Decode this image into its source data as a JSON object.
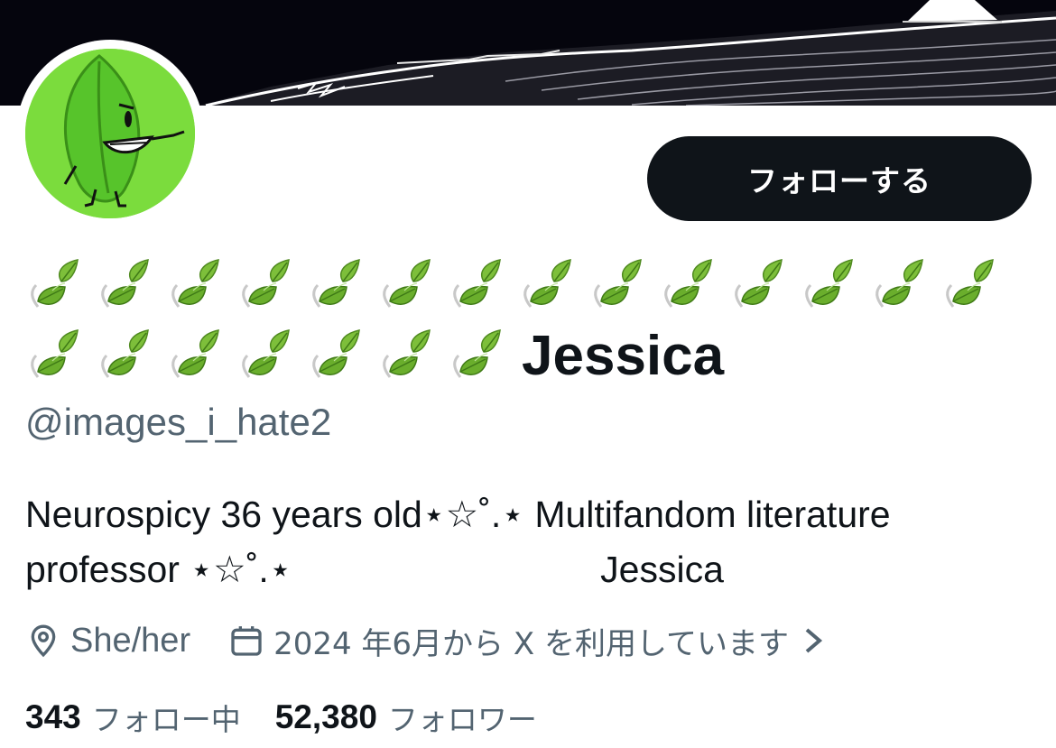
{
  "profile": {
    "display_name": "Jessica",
    "name_prefix_emoji": "leaf-emoji",
    "name_prefix_emoji_count": 21,
    "handle": "@images_i_hate2",
    "bio_line1": "Neurospicy 36 years old⋆☆˚.⋆ Multifandom literature",
    "bio_line2": "professor ⋆☆˚.⋆                              Jessica",
    "location": "She/her",
    "joined": "2024 年6月から X を利用しています",
    "following_count": "343",
    "following_label": "フォロー中",
    "followers_count": "52,380",
    "followers_label": "フォロワー"
  },
  "actions": {
    "follow_label": "フォローする"
  },
  "icons": {
    "location": "location-pin-icon",
    "calendar": "calendar-icon",
    "chevron": "chevron-right-icon",
    "avatar": "leaf-character-avatar"
  },
  "colors": {
    "text_primary": "#0f1419",
    "text_secondary": "#536471",
    "button_bg": "#0f1419",
    "avatar_bg": "#7bdc3d",
    "banner_bg": "#05050d"
  }
}
